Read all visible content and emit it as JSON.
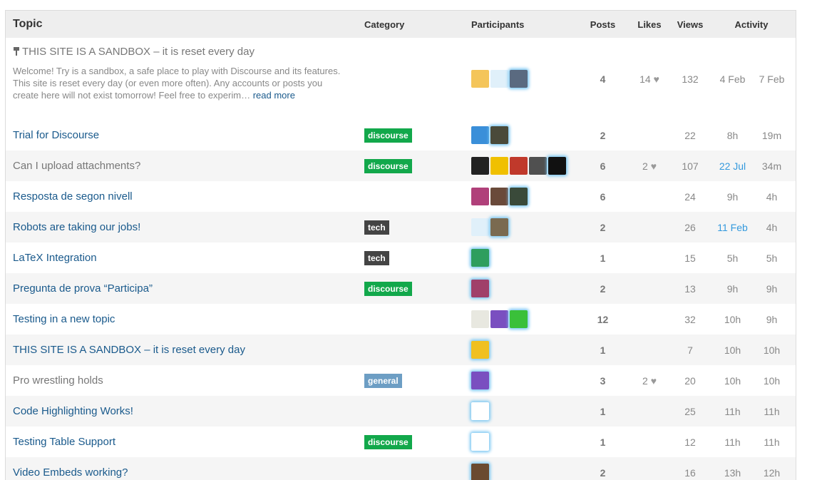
{
  "header": {
    "topic": "Topic",
    "category": "Category",
    "participants": "Participants",
    "posts": "Posts",
    "likes": "Likes",
    "views": "Views",
    "activity": "Activity"
  },
  "colors": {
    "link": "#1a5a8c",
    "visited": "#777777",
    "discourse_badge": "#12a84b",
    "tech_badge": "#444444",
    "general_badge": "#6d9ec4",
    "highlight_date": "#3399dd"
  },
  "pinned": {
    "title": "THIS SITE IS A SANDBOX – it is reset every day",
    "excerpt": "Welcome! Try is a sandbox, a safe place to play with Discourse and its features. This site is reset every day (or even more often). Any accounts or posts you create here will not exist tomorrow! Feel free to experim…",
    "read_more": "read more",
    "category": "",
    "avatars": [
      {
        "icon": "avatar-cartoon-face",
        "color": "#f4c55a",
        "latest": false
      },
      {
        "icon": "avatar-robot",
        "color": "#e0f0fa",
        "latest": false
      },
      {
        "icon": "avatar-photo-man",
        "color": "#5a6a80",
        "latest": true
      }
    ],
    "posts": "4",
    "likes": "14",
    "views": "132",
    "created": "4 Feb",
    "last": "7 Feb"
  },
  "topics": [
    {
      "title": "Trial for Discourse",
      "visited": false,
      "category": "discourse",
      "badge_color": "#12a84b",
      "avatars": [
        {
          "icon": "avatar-blue-pattern",
          "color": "#3a8fd9",
          "latest": false
        },
        {
          "icon": "avatar-photo-man",
          "color": "#4a4a3a",
          "latest": true
        }
      ],
      "posts": "2",
      "likes": "",
      "views": "22",
      "created": "8h",
      "last": "19m",
      "created_highlight": false
    },
    {
      "title": "Can I upload attachments?",
      "visited": true,
      "category": "discourse",
      "badge_color": "#12a84b",
      "avatars": [
        {
          "icon": "avatar-spiky-character",
          "color": "#222222",
          "latest": false
        },
        {
          "icon": "avatar-yellow-symbol",
          "color": "#f0c000",
          "latest": false
        },
        {
          "icon": "avatar-red-emblem",
          "color": "#c0392b",
          "latest": false
        },
        {
          "icon": "avatar-photo-man",
          "color": "#505050",
          "latest": false
        },
        {
          "icon": "avatar-black-pattern",
          "color": "#111111",
          "latest": true
        }
      ],
      "posts": "6",
      "likes": "2",
      "views": "107",
      "created": "22 Jul",
      "last": "34m",
      "created_highlight": true
    },
    {
      "title": "Resposta de segon nivell",
      "visited": false,
      "category": "",
      "badge_color": "",
      "avatars": [
        {
          "icon": "avatar-pink-pattern",
          "color": "#b0407a",
          "latest": false
        },
        {
          "icon": "avatar-photo-man",
          "color": "#6a4a3a",
          "latest": false
        },
        {
          "icon": "avatar-photo-man",
          "color": "#3a4a3a",
          "latest": true
        }
      ],
      "posts": "6",
      "likes": "",
      "views": "24",
      "created": "9h",
      "last": "4h",
      "created_highlight": false
    },
    {
      "title": "Robots are taking our jobs!",
      "visited": false,
      "category": "tech",
      "badge_color": "#444444",
      "avatars": [
        {
          "icon": "avatar-robot",
          "color": "#e0f0fa",
          "latest": false
        },
        {
          "icon": "avatar-photo-man",
          "color": "#7a6a50",
          "latest": true
        }
      ],
      "posts": "2",
      "likes": "",
      "views": "26",
      "created": "11 Feb",
      "last": "4h",
      "created_highlight": true
    },
    {
      "title": "LaTeX Integration",
      "visited": false,
      "category": "tech",
      "badge_color": "#444444",
      "avatars": [
        {
          "icon": "avatar-green-pattern",
          "color": "#2e9e5e",
          "latest": true
        }
      ],
      "posts": "1",
      "likes": "",
      "views": "15",
      "created": "5h",
      "last": "5h",
      "created_highlight": false
    },
    {
      "title": "Pregunta de prova “Participa”",
      "visited": false,
      "category": "discourse",
      "badge_color": "#12a84b",
      "avatars": [
        {
          "icon": "avatar-pink-pattern",
          "color": "#a0406a",
          "latest": true
        }
      ],
      "posts": "2",
      "likes": "",
      "views": "13",
      "created": "9h",
      "last": "9h",
      "created_highlight": false
    },
    {
      "title": "Testing in a new topic",
      "visited": false,
      "category": "",
      "badge_color": "",
      "avatars": [
        {
          "icon": "avatar-light-pattern",
          "color": "#e8e8e0",
          "latest": false
        },
        {
          "icon": "avatar-purple-pattern",
          "color": "#7a4fc0",
          "latest": false
        },
        {
          "icon": "avatar-green-dots",
          "color": "#3ac03a",
          "latest": true
        }
      ],
      "posts": "12",
      "likes": "",
      "views": "32",
      "created": "10h",
      "last": "9h",
      "created_highlight": false
    },
    {
      "title": "THIS SITE IS A SANDBOX – it is reset every day",
      "visited": false,
      "category": "",
      "badge_color": "",
      "avatars": [
        {
          "icon": "avatar-yellow-figure",
          "color": "#f0c020",
          "latest": true
        }
      ],
      "posts": "1",
      "likes": "",
      "views": "7",
      "created": "10h",
      "last": "10h",
      "created_highlight": false
    },
    {
      "title": "Pro wrestling holds",
      "visited": true,
      "category": "general",
      "badge_color": "#6d9ec4",
      "avatars": [
        {
          "icon": "avatar-purple-pattern",
          "color": "#7a4fc0",
          "latest": true
        }
      ],
      "posts": "3",
      "likes": "2",
      "views": "20",
      "created": "10h",
      "last": "10h",
      "created_highlight": false
    },
    {
      "title": "Code Highlighting Works!",
      "visited": false,
      "category": "",
      "badge_color": "",
      "avatars": [
        {
          "icon": "avatar-sketch-face",
          "color": "#ffffff",
          "latest": true
        }
      ],
      "posts": "1",
      "likes": "",
      "views": "25",
      "created": "11h",
      "last": "11h",
      "created_highlight": false
    },
    {
      "title": "Testing Table Support",
      "visited": false,
      "category": "discourse",
      "badge_color": "#12a84b",
      "avatars": [
        {
          "icon": "avatar-sketch-face",
          "color": "#ffffff",
          "latest": true
        }
      ],
      "posts": "1",
      "likes": "",
      "views": "12",
      "created": "11h",
      "last": "11h",
      "created_highlight": false
    },
    {
      "title": "Video Embeds working?",
      "visited": false,
      "category": "",
      "badge_color": "",
      "avatars": [
        {
          "icon": "avatar-photo-man",
          "color": "#6a4a30",
          "latest": true
        }
      ],
      "posts": "2",
      "likes": "",
      "views": "16",
      "created": "13h",
      "last": "12h",
      "created_highlight": false
    }
  ]
}
